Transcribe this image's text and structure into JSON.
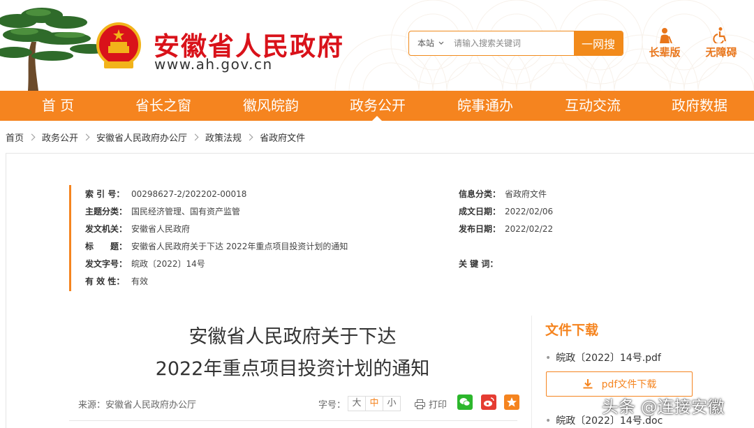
{
  "site": {
    "title": "安徽省人民政府",
    "url": "www.ah.gov.cn"
  },
  "search": {
    "scope": "本站",
    "placeholder": "请输入搜索关键词",
    "button": "一网搜"
  },
  "quick_links": [
    {
      "label": "长辈版",
      "icon": "elder-icon"
    },
    {
      "label": "无障碍",
      "icon": "accessibility-icon"
    }
  ],
  "nav": [
    {
      "label": "首 页"
    },
    {
      "label": "省长之窗"
    },
    {
      "label": "徽风皖韵"
    },
    {
      "label": "政务公开"
    },
    {
      "label": "皖事通办"
    },
    {
      "label": "互动交流"
    },
    {
      "label": "政府数据"
    }
  ],
  "breadcrumb": [
    "首页",
    "政务公开",
    "安徽省人民政府办公厅",
    "政策法规",
    "省政府文件"
  ],
  "meta": {
    "index_label": "索 引 号：",
    "index_value": "00298627-2/202202-00018",
    "category_label": "信息分类：",
    "category_value": "省政府文件",
    "topic_label": "主题分类：",
    "topic_value": "国民经济管理、国有资产监管",
    "created_label": "成文日期：",
    "created_value": "2022/02/06",
    "issuer_label": "发文机关：",
    "issuer_value": "安徽省人民政府",
    "published_label": "发布日期：",
    "published_value": "2022/02/22",
    "subject_label": "标　　题：",
    "subject_value": "安徽省人民政府关于下达 2022年重点项目投资计划的通知",
    "doc_no_label": "发文字号：",
    "doc_no_value": "皖政〔2022〕14号",
    "keywords_label": "关 键 词：",
    "keywords_value": "",
    "validity_label": "有 效 性：",
    "validity_value": "有效"
  },
  "document": {
    "title_line1": "安徽省人民政府关于下达",
    "title_line2": "2022年重点项目投资计划的通知",
    "source": "来源：安徽省人民政府办公厅",
    "font_size_label": "字号：",
    "font_sizes": [
      "大",
      "中",
      "小"
    ],
    "print": "打印"
  },
  "downloads": {
    "title": "文件下载",
    "files": [
      "皖政〔2022〕14号.pdf",
      "皖政〔2022〕14号.doc"
    ],
    "button": "pdf文件下载"
  },
  "watermark": "头条 @连接安徽",
  "colors": {
    "accent": "#f5841f",
    "title_red": "#d9121a"
  }
}
